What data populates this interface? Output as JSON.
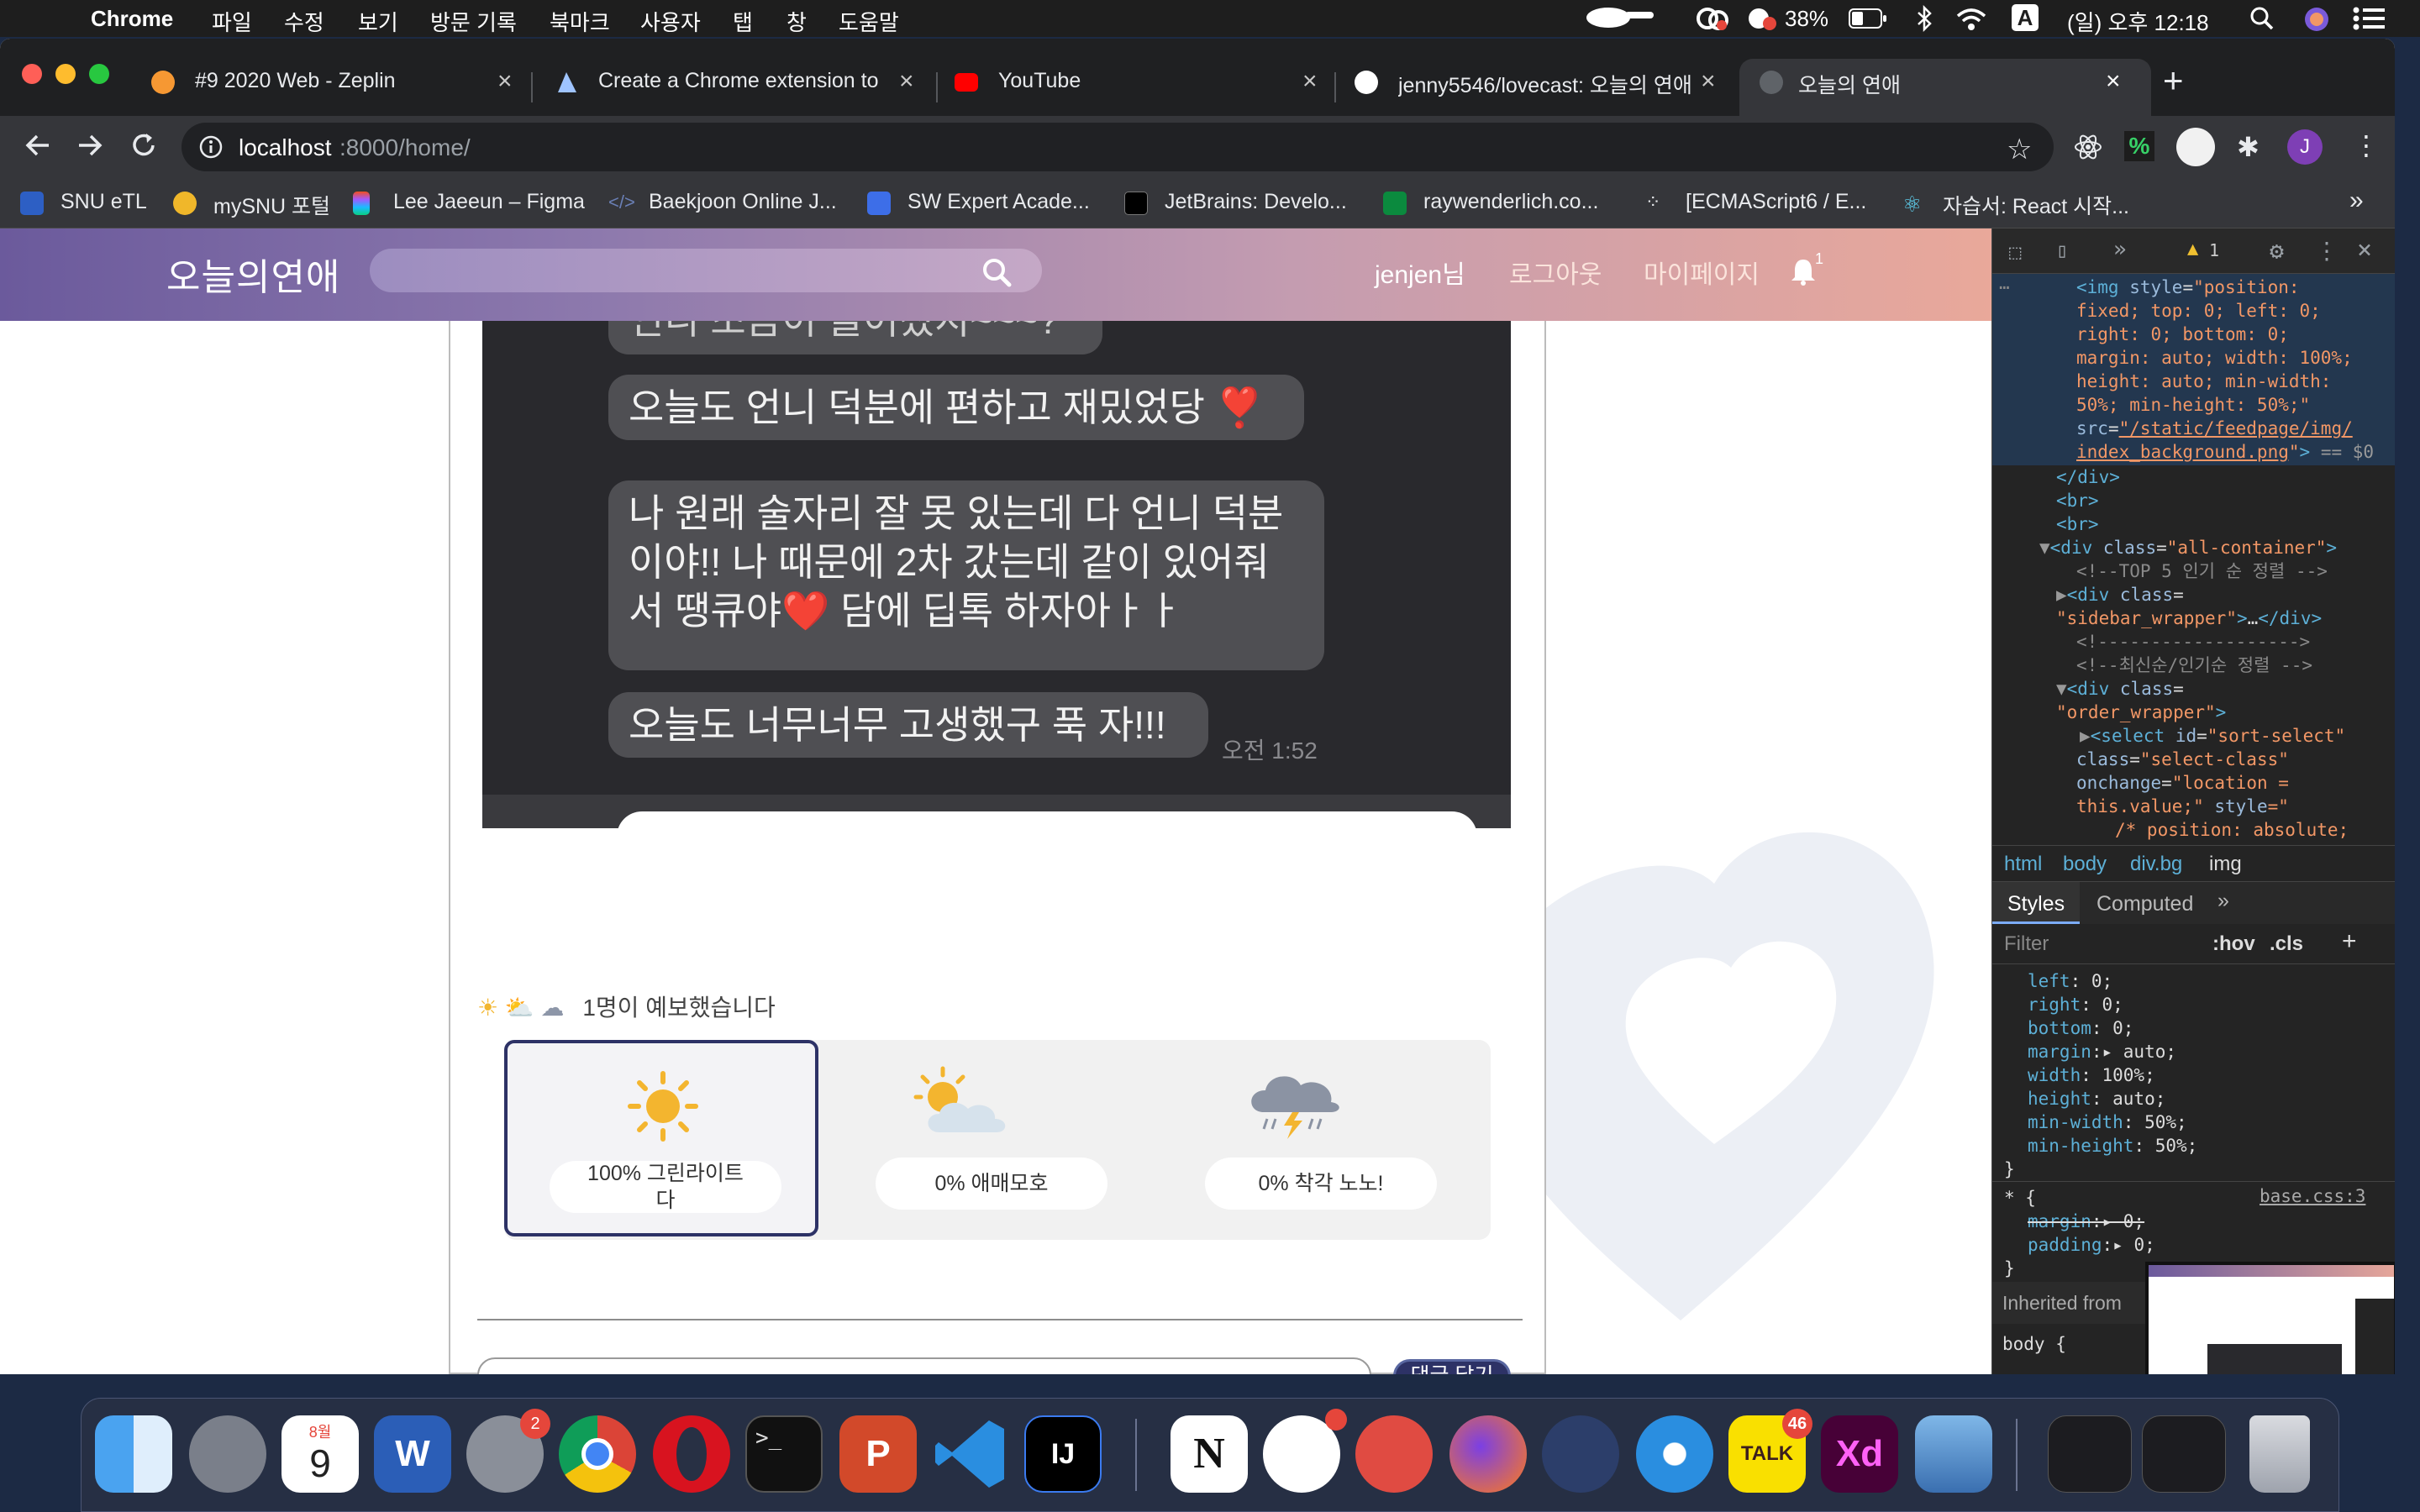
{
  "menubar": {
    "app": "Chrome",
    "items": [
      "파일",
      "수정",
      "보기",
      "방문 기록",
      "북마크",
      "사용자",
      "탭",
      "창",
      "도움말"
    ],
    "battery": "38%",
    "input": "A",
    "clock": "(일) 오후 12:18"
  },
  "tabs": [
    {
      "title": "#9 2020 Web - Zeplin"
    },
    {
      "title": "Create a Chrome extension to"
    },
    {
      "title": "YouTube"
    },
    {
      "title": "jenny5546/lovecast: 오늘의 연애"
    },
    {
      "title": "오늘의 연애"
    }
  ],
  "toolbar": {
    "url_host": "localhost",
    "url_rest": ":8000/home/",
    "profile_initial": "J",
    "ext_percent": "%"
  },
  "bookmarks": [
    {
      "label": "SNU eTL"
    },
    {
      "label": "mySNU 포털"
    },
    {
      "label": "Lee Jaeeun – Figma"
    },
    {
      "label": "Baekjoon Online J..."
    },
    {
      "label": "SW Expert Acade..."
    },
    {
      "label": "JetBrains: Develo..."
    },
    {
      "label": "raywenderlich.co..."
    },
    {
      "label": "[ECMAScript6 / E..."
    },
    {
      "label": "자습서: React 시작..."
    }
  ],
  "site": {
    "logo": "오늘의연애",
    "user": "jenjen님",
    "logout": "로그아웃",
    "mypage": "마이페이지",
    "notif_count": "1"
  },
  "chat": {
    "partial": "언니 조금이 늘어졌지~~~?",
    "msg1": "오늘도 언니 덕분에 편하고 재밌었당 ❣️",
    "msg2_l1": "나 원래 술자리 잘 못 있는데 다 언니 덕분",
    "msg2_l2": "이야!! 나 때문에 2차 갔는데 같이 있어줘",
    "msg2_l3": "서 땡큐야❤️ 담에 딥톡 하자아ㅏㅏ",
    "msg3": "오늘도 너무너무 고생했구 푹 자!!!",
    "time": "오전 1:52"
  },
  "vote": {
    "count_text": "1명이 예보했습니다",
    "options": [
      {
        "icon": "sun-icon",
        "label": "100% 그린라이트다",
        "percent": 100
      },
      {
        "icon": "sun-cloud-icon",
        "label": "0% 애매모호",
        "percent": 0
      },
      {
        "icon": "storm-icon",
        "label": "0% 착각 노노!",
        "percent": 0
      }
    ],
    "selected": 0
  },
  "comment": {
    "button": "댓글 달기"
  },
  "devtools": {
    "warn_count": "1",
    "crumbs": [
      "html",
      "body",
      "div.bg",
      "img"
    ],
    "tabs": [
      "Styles",
      "Computed"
    ],
    "filter": "Filter",
    "hov": ":hov",
    "cls": ".cls",
    "source": "base.css:3",
    "inherited": "Inherited from",
    "body_rule": "body {"
  },
  "dock": {
    "calendar_month": "8월",
    "calendar_day": "9",
    "badges": {
      "settings": "2",
      "kakao": "46"
    }
  },
  "colors": {
    "nav_start": "#6b5a9c",
    "nav_end": "#e9a89a",
    "selected_border": "#2d3266",
    "chat_bg": "#29292d"
  }
}
